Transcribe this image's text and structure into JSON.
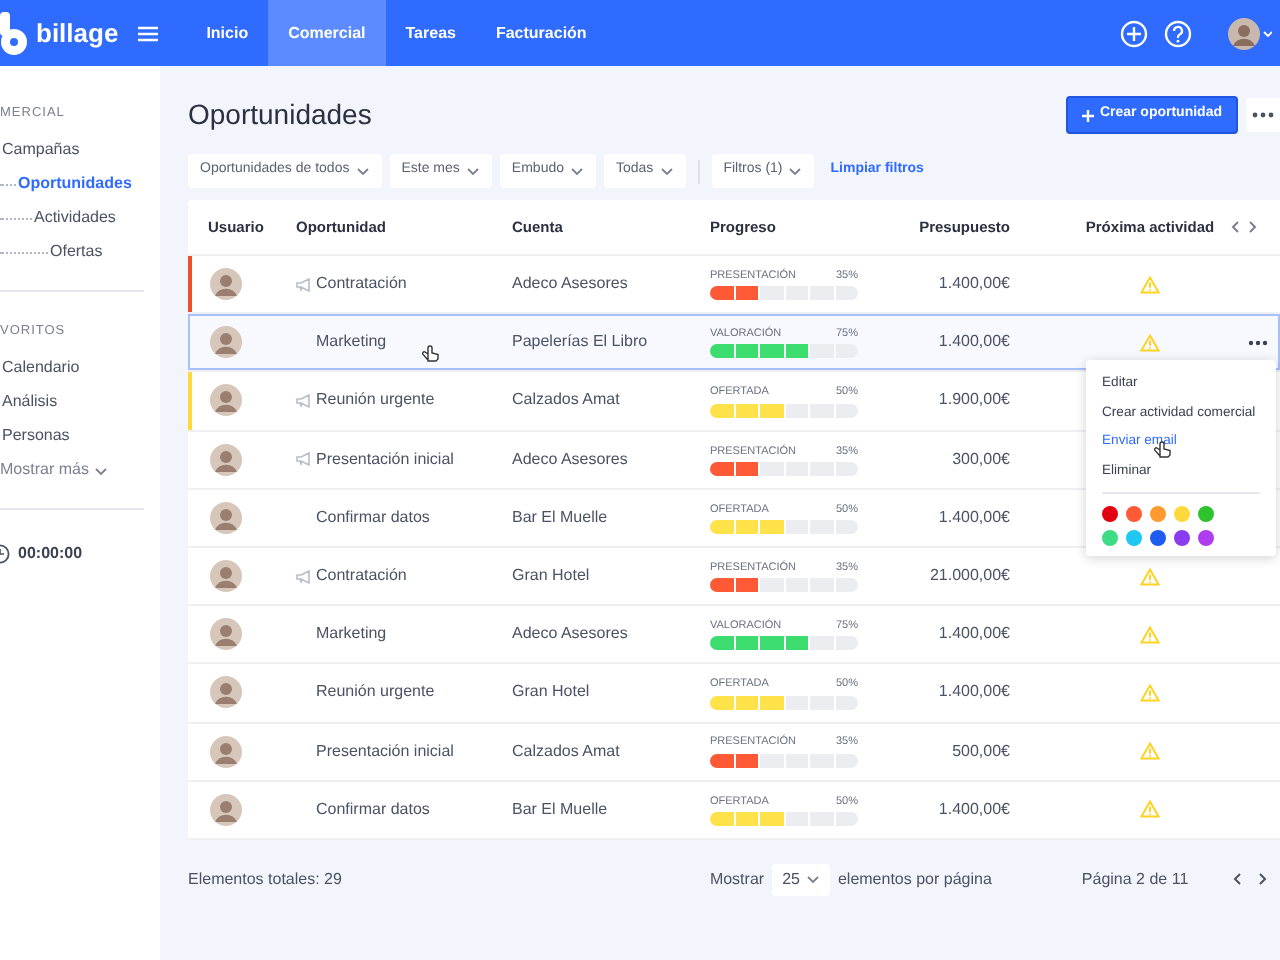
{
  "navbar": {
    "brand": "billage",
    "items": [
      {
        "label": "Inicio",
        "selected": false
      },
      {
        "label": "Comercial",
        "selected": true
      },
      {
        "label": "Tareas",
        "selected": false
      },
      {
        "label": "Facturación",
        "selected": false
      }
    ]
  },
  "sidebar": {
    "sections": [
      {
        "title": "MERCIAL",
        "items": [
          {
            "label": "Campañas",
            "selected": false,
            "children": [
              {
                "label": "Oportunidades",
                "selected": true,
                "children": [
                  {
                    "label": "Actividades",
                    "selected": false,
                    "children": [
                      {
                        "label": "Ofertas",
                        "selected": false
                      }
                    ]
                  }
                ]
              }
            ]
          }
        ]
      },
      {
        "title": "VORITOS",
        "items": [
          {
            "label": "Calendario",
            "selected": false
          },
          {
            "label": "Análisis",
            "selected": false
          },
          {
            "label": "Personas",
            "selected": false
          }
        ],
        "more": "Mostrar más"
      }
    ],
    "timer": "00:00:00"
  },
  "page": {
    "title": "Oportunidades",
    "create_button": "Crear oportunidad"
  },
  "filters": {
    "dropdowns": [
      "Oportunidades de todos",
      "Este mes",
      "Embudo",
      "Todas"
    ],
    "filter_button": "Filtros (1)",
    "clear_link": "Limpiar filtros"
  },
  "table": {
    "columns": [
      "Usuario",
      "Oportunidad",
      "Cuenta",
      "Progreso",
      "Presupuesto",
      "Próxima actividad"
    ],
    "rows": [
      {
        "opportunity": "Contratación",
        "account": "Adeco Asesores",
        "progress": {
          "stage": "PRESENTACIÓN",
          "percent": "35%",
          "level": 0.33,
          "color": "#ff5a36"
        },
        "budget": "1.400,00€",
        "announce": true,
        "alert": true,
        "selected": false,
        "color": "#f0502f"
      },
      {
        "opportunity": "Marketing",
        "account": "Papelerías El Libro",
        "progress": {
          "stage": "VALORACIÓN",
          "percent": "75%",
          "level": 0.67,
          "color": "#3ddc6e"
        },
        "budget": "1.400,00€",
        "announce": false,
        "alert": true,
        "selected": true
      },
      {
        "opportunity": "Reunión urgente",
        "account": "Calzados Amat",
        "progress": {
          "stage": "OFERTADA",
          "percent": "50%",
          "level": 0.5,
          "color": "#ffe14a"
        },
        "budget": "1.900,00€",
        "announce": true,
        "alert": false,
        "selected": false,
        "color": "#ffd93b"
      },
      {
        "opportunity": "Presentación inicial",
        "account": "Adeco Asesores",
        "progress": {
          "stage": "PRESENTACIÓN",
          "percent": "35%",
          "level": 0.33,
          "color": "#ff5a36"
        },
        "budget": "300,00€",
        "announce": true,
        "alert": false,
        "selected": false
      },
      {
        "opportunity": "Confirmar datos",
        "account": "Bar El Muelle",
        "progress": {
          "stage": "OFERTADA",
          "percent": "50%",
          "level": 0.5,
          "color": "#ffe14a"
        },
        "budget": "1.400,00€",
        "announce": false,
        "alert": false,
        "selected": false
      },
      {
        "opportunity": "Contratación",
        "account": "Gran Hotel",
        "progress": {
          "stage": "PRESENTACIÓN",
          "percent": "35%",
          "level": 0.33,
          "color": "#ff5a36"
        },
        "budget": "21.000,00€",
        "announce": true,
        "alert": true,
        "selected": false
      },
      {
        "opportunity": "Marketing",
        "account": "Adeco Asesores",
        "progress": {
          "stage": "VALORACIÓN",
          "percent": "75%",
          "level": 0.67,
          "color": "#3ddc6e"
        },
        "budget": "1.400,00€",
        "announce": false,
        "alert": true,
        "selected": false
      },
      {
        "opportunity": "Reunión urgente",
        "account": "Gran Hotel",
        "progress": {
          "stage": "OFERTADA",
          "percent": "50%",
          "level": 0.5,
          "color": "#ffe14a"
        },
        "budget": "1.400,00€",
        "announce": false,
        "alert": true,
        "selected": false
      },
      {
        "opportunity": "Presentación inicial",
        "account": "Calzados Amat",
        "progress": {
          "stage": "PRESENTACIÓN",
          "percent": "35%",
          "level": 0.33,
          "color": "#ff5a36"
        },
        "budget": "500,00€",
        "announce": false,
        "alert": true,
        "selected": false
      },
      {
        "opportunity": "Confirmar datos",
        "account": "Bar El Muelle",
        "progress": {
          "stage": "OFERTADA",
          "percent": "50%",
          "level": 0.5,
          "color": "#ffe14a"
        },
        "budget": "1.400,00€",
        "announce": false,
        "alert": true,
        "selected": false
      }
    ]
  },
  "context_menu": {
    "items": [
      {
        "label": "Editar",
        "hovered": false
      },
      {
        "label": "Crear actividad comercial",
        "hovered": false
      },
      {
        "label": "Enviar email",
        "hovered": true
      },
      {
        "label": "Eliminar",
        "hovered": false
      }
    ],
    "colors": [
      {
        "color": "#e3000f"
      },
      {
        "color": "#ff5a36"
      },
      {
        "color": "#ff9a2e"
      },
      {
        "color": "#ffd93b"
      },
      {
        "color": "#2ec22e"
      },
      {
        "color": "#3ddc84"
      },
      {
        "color": "#1ec8f0"
      },
      {
        "color": "#1e5cf0"
      },
      {
        "color": "#8a3cf0"
      },
      {
        "color": "#b03cf0"
      }
    ]
  },
  "footer": {
    "total": "Elementos totales: 29",
    "show_label": "Mostrar",
    "page_size": "25",
    "per_page": "elementos por página",
    "page_info": "Página 2 de 11"
  }
}
